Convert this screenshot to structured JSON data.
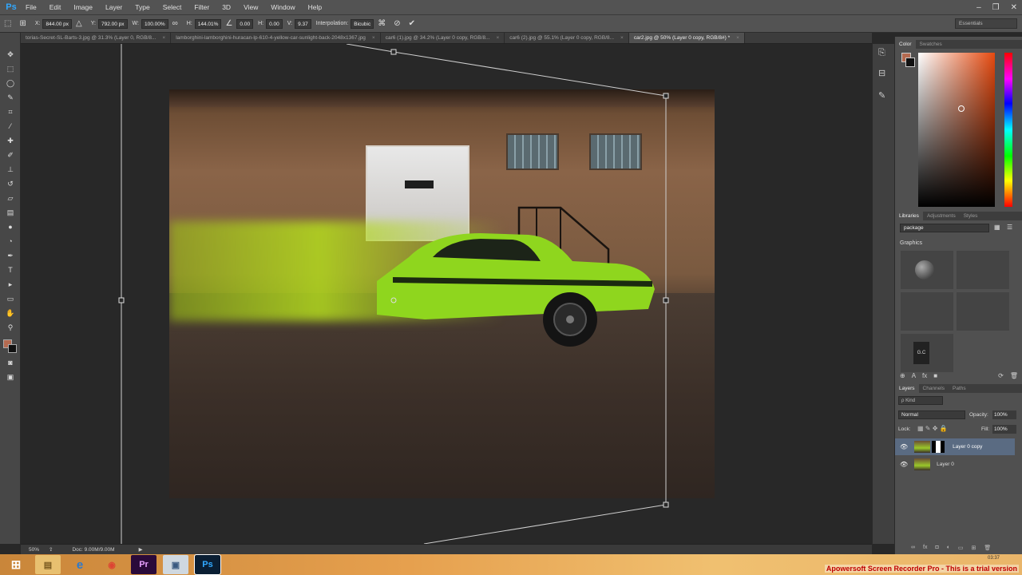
{
  "app": {
    "logo": "Ps"
  },
  "menu": [
    "File",
    "Edit",
    "Image",
    "Layer",
    "Type",
    "Select",
    "Filter",
    "3D",
    "View",
    "Window",
    "Help"
  ],
  "window_controls": {
    "minimize": "–",
    "restore": "❐",
    "close": "✕"
  },
  "options": {
    "x_label": "X:",
    "x_value": "844.00 px",
    "y_label": "Y:",
    "y_value": "792.00 px",
    "w_label": "W:",
    "w_value": "100.00%",
    "h_label": "H:",
    "h_value": "144.01%",
    "angle_value": "0.00",
    "hskew_label": "H:",
    "hskew_value": "0.00",
    "vskew_label": "V:",
    "vskew_value": "9.37",
    "interp_label": "Interpolation:",
    "interp_value": "Bicubic",
    "workspace": "Essentials"
  },
  "tabs": [
    {
      "label": "torias-Secret-SL-Barts-3.jpg @ 31.3% (Layer 0, RGB/8...",
      "active": false
    },
    {
      "label": "lamborghini-lamborghini-huracan-lp-610-4-yellow-car-sunlight-back-2048x1367.jpg",
      "active": false
    },
    {
      "label": "car6 (1).jpg @ 34.2% (Layer 0 copy, RGB/8...",
      "active": false
    },
    {
      "label": "car6 (2).jpg @ 55.1% (Layer 0 copy, RGB/8...",
      "active": false
    },
    {
      "label": "car2.jpg @ 50% (Layer 0 copy, RGB/8#) *",
      "active": true
    }
  ],
  "status": {
    "zoom": "50%",
    "doc": "Doc: 9.00M/9.00M"
  },
  "color_panel": {
    "tabs": [
      "Color",
      "Swatches"
    ],
    "fg": "#b46a50",
    "bg": "#111111"
  },
  "libraries": {
    "tabs": [
      "Libraries",
      "Adjustments",
      "Styles"
    ],
    "library": "package",
    "section": "Graphics",
    "tile_text": "G.C"
  },
  "layers": {
    "tabs": [
      "Layers",
      "Channels",
      "Paths"
    ],
    "kind": "ρ Kind",
    "blend": "Normal",
    "opacity_label": "Opacity:",
    "opacity": "100%",
    "lock_label": "Lock:",
    "fill_label": "Fill:",
    "fill": "100%",
    "items": [
      {
        "name": "Layer 0 copy",
        "selected": true
      },
      {
        "name": "Layer 0",
        "selected": false
      }
    ]
  },
  "taskbar": {
    "watermark": "Apowersoft Screen Recorder Pro - This is a trial version",
    "clock": "03:37"
  }
}
